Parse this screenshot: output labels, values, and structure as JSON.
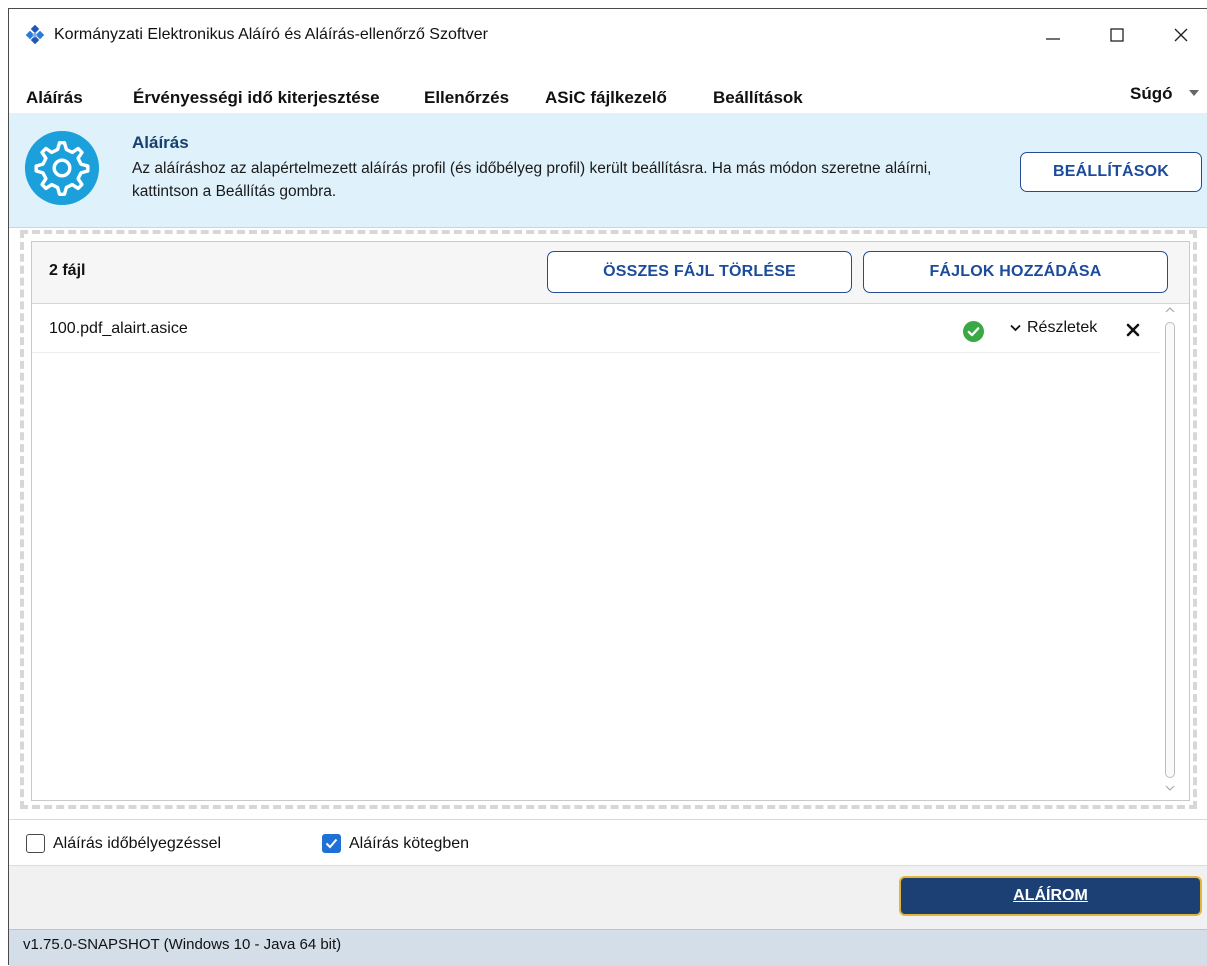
{
  "window": {
    "title": "Kormányzati Elektronikus Aláíró és Aláírás-ellenőrző Szoftver",
    "controls": [
      "minimize-icon",
      "maximize-icon",
      "close-icon"
    ]
  },
  "menu": {
    "items": [
      "Aláírás",
      "Érvényességi idő kiterjesztése",
      "Ellenőrzés",
      "ASiC fájlkezelő",
      "Beállítások"
    ],
    "help": "Súgó"
  },
  "banner": {
    "icon": "gear-icon",
    "title": "Aláírás",
    "text": "Az aláíráshoz az alapértelmezett aláírás profil (és időbélyeg profil) került beállításra. Ha más módon szeretne aláírni, kattintson a Beállítás gombra.",
    "settings_button": "BEÁLLÍTÁSOK"
  },
  "files": {
    "count_label": "2 fájl",
    "delete_all_button": "ÖSSZES FÁJL TÖRLÉSE",
    "add_files_button": "FÁJLOK HOZZÁDÁSA",
    "list": [
      {
        "name": "100.pdf_alairt.asice",
        "status_icon": "check-circle-icon",
        "details_label": "Részletek"
      }
    ]
  },
  "options": {
    "timestamp_label": "Aláírás időbélyegzéssel",
    "timestamp_checked": false,
    "batch_label": "Aláírás kötegben",
    "batch_checked": true
  },
  "footer": {
    "sign_button": "ALÁÍROM",
    "version": "v1.75.0-SNAPSHOT (Windows 10 - Java 64 bit)"
  },
  "colors": {
    "banner_bg": "#dff2fb",
    "accent": "#1c4b9c",
    "sign_button_bg": "#1c3f74",
    "sign_button_border": "#e1b63b",
    "ok_green": "#3aa845",
    "statusbar_bg": "#d3dee8"
  }
}
